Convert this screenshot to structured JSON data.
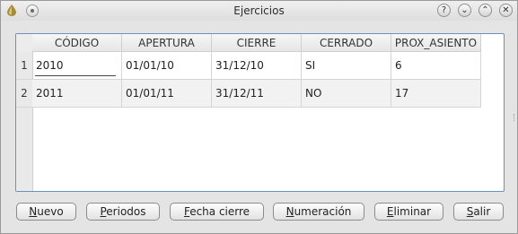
{
  "window": {
    "title": "Ejercicios"
  },
  "title_buttons": [
    "?",
    "⌄",
    "⌃",
    "✕"
  ],
  "grid": {
    "columns": [
      "CÓDIGO",
      "APERTURA",
      "CIERRE",
      "CERRADO",
      "PROX_ASIENTO"
    ],
    "rows": [
      {
        "index": "1",
        "cells": [
          "2010",
          "01/01/10",
          "31/12/10",
          "SI",
          "6"
        ]
      },
      {
        "index": "2",
        "cells": [
          "2011",
          "01/01/11",
          "31/12/11",
          "NO",
          "17"
        ]
      }
    ]
  },
  "buttons": [
    {
      "mnemonic": "N",
      "rest": "uevo"
    },
    {
      "mnemonic": "P",
      "rest": "eriodos"
    },
    {
      "mnemonic": "F",
      "rest": "echa cierre"
    },
    {
      "mnemonic": "N",
      "rest": "umeración"
    },
    {
      "mnemonic": "E",
      "rest": "liminar"
    },
    {
      "mnemonic": "S",
      "rest": "alir"
    }
  ],
  "colors": {
    "accent_border": "#6d8fc4"
  }
}
